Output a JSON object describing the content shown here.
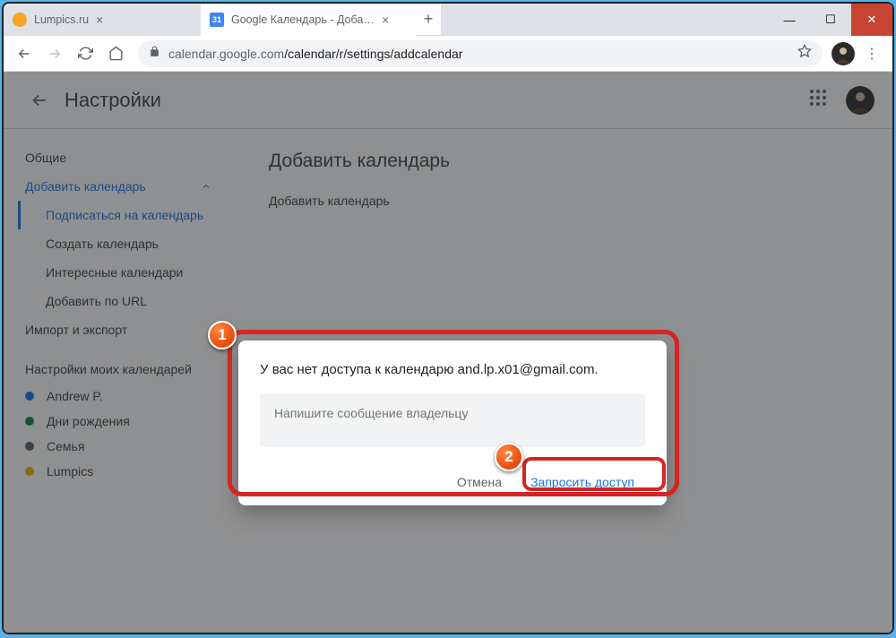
{
  "window": {
    "tabs": [
      {
        "title": "Lumpics.ru",
        "favicon_color": "#f5a623"
      },
      {
        "title": "Google Календарь - Добавить к",
        "favicon_color": "#4285f4"
      }
    ],
    "url_host": "calendar.google.com",
    "url_path": "/calendar/r/settings/addcalendar"
  },
  "header": {
    "title": "Настройки"
  },
  "sidebar": {
    "general": "Общие",
    "add_calendar": "Добавить календарь",
    "sub": {
      "subscribe": "Подписаться на календарь",
      "create": "Создать календарь",
      "interesting": "Интересные календари",
      "by_url": "Добавить по URL"
    },
    "import_export": "Импорт и экспорт",
    "my_calendars_heading": "Настройки моих календарей",
    "my_calendars": [
      {
        "label": "Andrew P.",
        "color": "#1a73e8"
      },
      {
        "label": "Дни рождения",
        "color": "#0b8043"
      },
      {
        "label": "Семья",
        "color": "#616161"
      },
      {
        "label": "Lumpics",
        "color": "#f4b400"
      }
    ]
  },
  "main": {
    "heading": "Добавить календарь",
    "subheading": "Добавить календарь"
  },
  "dialog": {
    "title": "У вас нет доступа к календарю and.lp.x01@gmail.com.",
    "placeholder": "Напишите сообщение владельцу",
    "cancel": "Отмена",
    "submit": "Запросить доступ"
  },
  "badges": {
    "one": "1",
    "two": "2"
  }
}
